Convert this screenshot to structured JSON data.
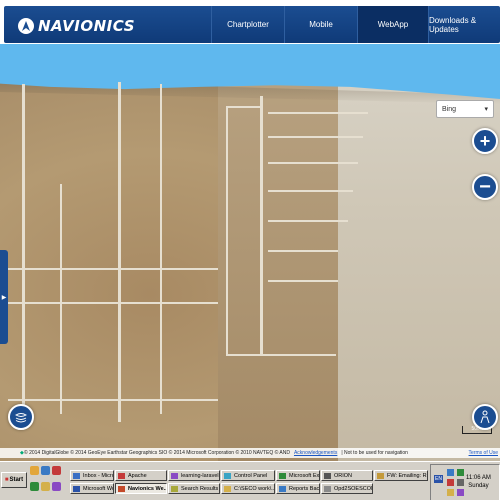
{
  "app": {
    "brand": "NAVIONICS",
    "nav_tabs": [
      "Chartplotter",
      "Mobile",
      "WebApp",
      "Downloads & Updates"
    ],
    "active_tab": "WebApp"
  },
  "map": {
    "layer_select": "Bing",
    "zoom_in_label": "+",
    "zoom_out_label": "−",
    "scale_label": "500ft",
    "attribution": "© 2014 DigitalGlobe  © 2014 GeoEye  Earthstar Geographics SIO  © 2014 Microsoft Corporation  © 2010 NAVTEQ  © AND",
    "acknowledgements_link": "Acknowledgements",
    "disclaimer": "| Not to be used for navigation",
    "terms_link": "Terms of Use"
  },
  "taskbar": {
    "start_label": "Start",
    "windows": [
      {
        "label": "Inbox - Micros...",
        "color": "#3a6fc4"
      },
      {
        "label": "Apache",
        "color": "#c43a3a"
      },
      {
        "label": "learning-laravel...",
        "color": "#8a4ac4"
      },
      {
        "label": "Control Panel",
        "color": "#3aa4c4"
      },
      {
        "label": "Microsoft Excel ...",
        "color": "#2e8b3a"
      },
      {
        "label": "ORION",
        "color": "#555555"
      },
      {
        "label": "FW: Emailing: R...",
        "color": "#c49a3a"
      },
      {
        "label": "Microsoft Word",
        "color": "#2a52a8"
      },
      {
        "label": "Navionics We...",
        "color": "#c44a2a"
      },
      {
        "label": "Search Results",
        "color": "#a8a83a"
      },
      {
        "label": "C:\\SECO work\\...",
        "color": "#d4b04a"
      },
      {
        "label": "Reports Backgr...",
        "color": "#3a7ac4"
      },
      {
        "label": "Opd2SOESCONE...",
        "color": "#8a8a8a"
      }
    ],
    "active_window": "Navionics We...",
    "clock_time": "11:06 AM",
    "clock_day": "Sunday"
  }
}
